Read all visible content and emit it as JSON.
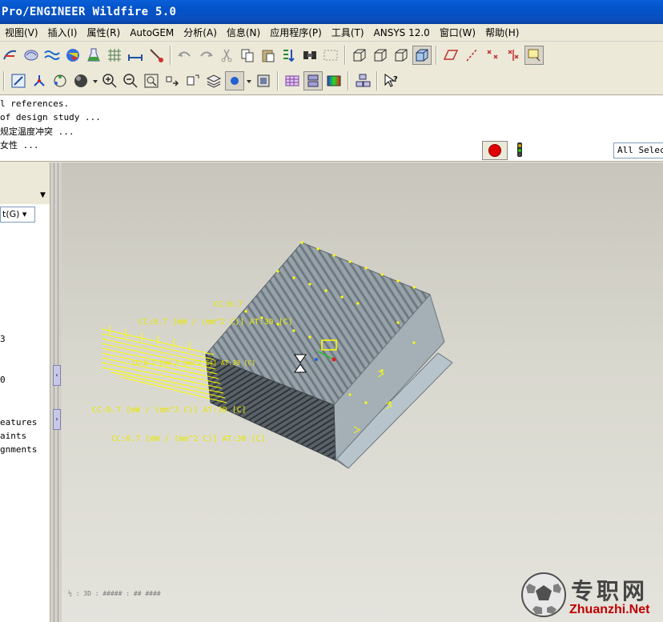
{
  "window": {
    "title": "Pro/ENGINEER Wildfire 5.0"
  },
  "menu": [
    "视图(V)",
    "插入(I)",
    "属性(R)",
    "AutoGEM",
    "分析(A)",
    "信息(N)",
    "应用程序(P)",
    "工具(T)",
    "ANSYS 12.0",
    "窗口(W)",
    "帮助(H)"
  ],
  "messages": [
    "l references.",
    "of design study ...",
    "规定温度冲突 ...",
    "女性 ..."
  ],
  "filter": {
    "value": "All Selec"
  },
  "navigator": {
    "filter_label": "t(G) ▾",
    "tree": [
      "3",
      "0",
      "eatures",
      "aints",
      "gnments"
    ]
  },
  "graphics": {
    "load_labels": [
      "CC:0.7",
      "CC:0.7 [mW / (mm^2 C)] AT:30 [C]",
      "CC:0.7 [mW / (mm^2 C)] AT:30 [C]",
      "CC:0.7 [mW / (mm^2 C)] AT:30 [C]",
      "CC:0.7 [mW / (mm^2 C)] AT:30 [C]"
    ],
    "statusline": "½ : 3D : ##### : ## ####"
  },
  "watermark": {
    "cn": "专职网",
    "en": "Zhuanzhi.Net"
  },
  "colors": {
    "titlebar": "#0353c8",
    "model": "#9aa4ab",
    "loads": "#ffff00",
    "stop": "#e00000"
  }
}
